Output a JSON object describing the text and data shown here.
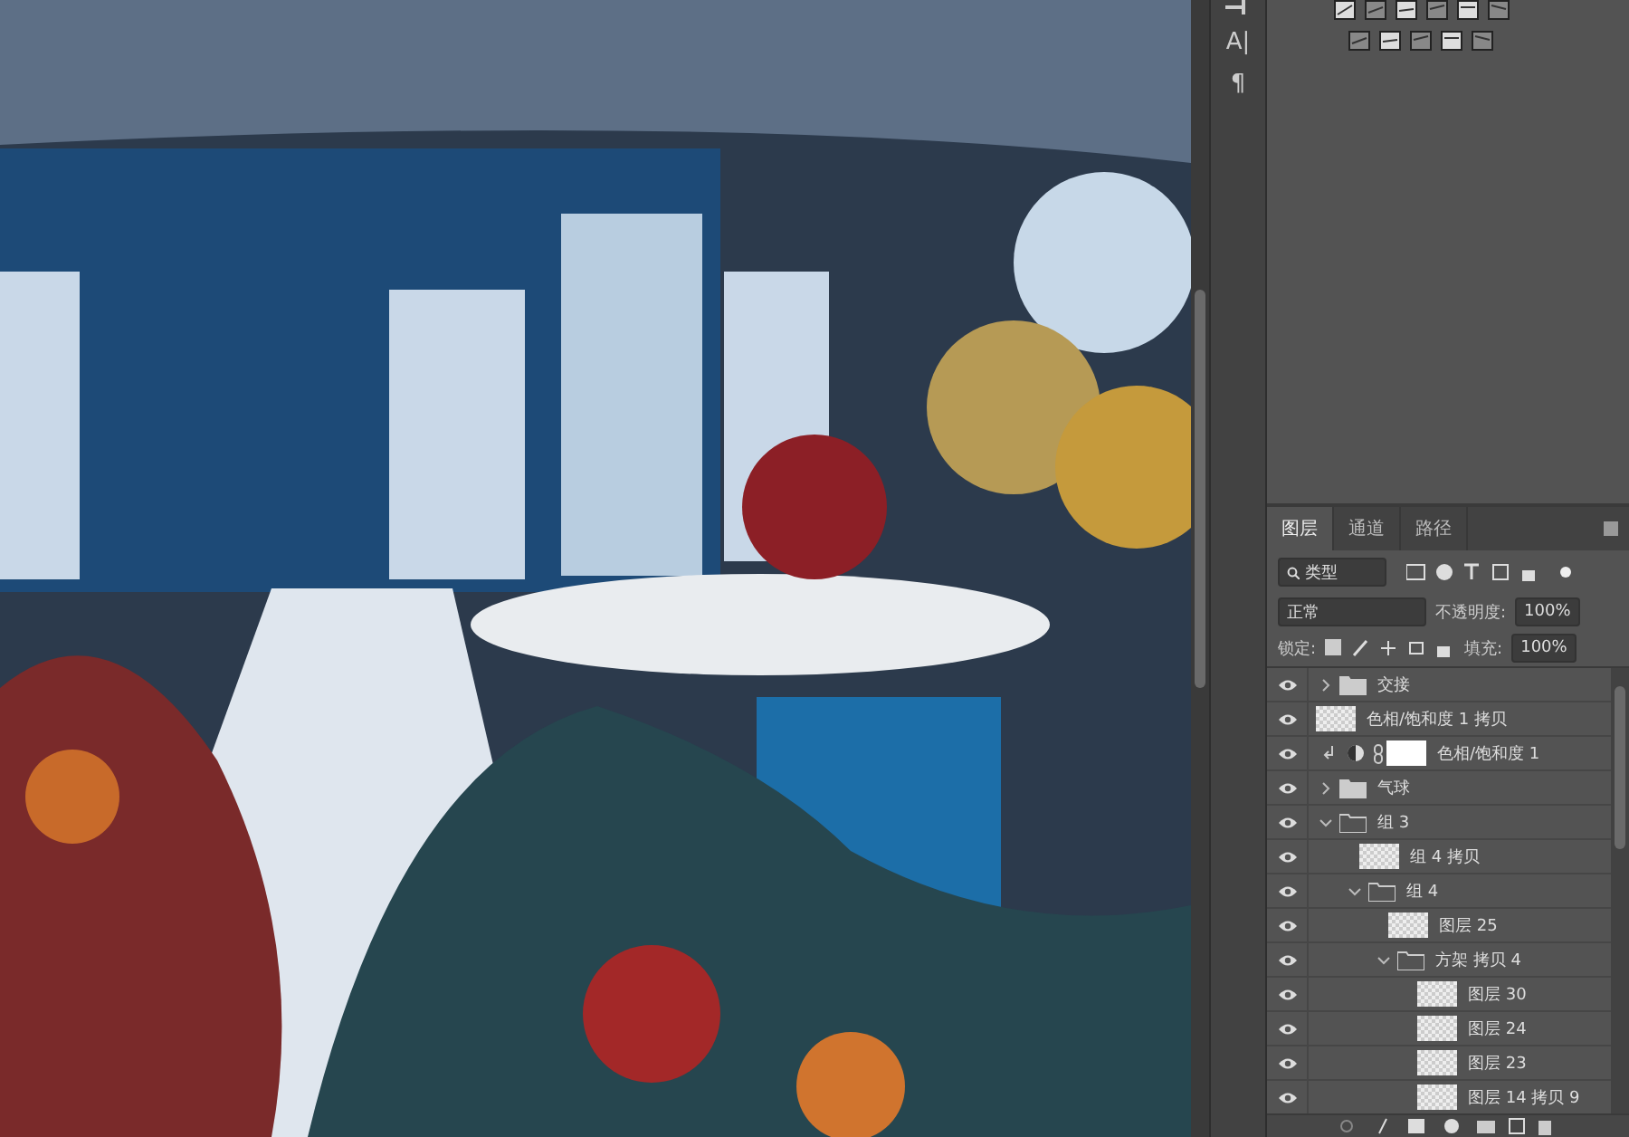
{
  "toolbar_glyphs": [
    "A|",
    "¶"
  ],
  "layers_panel": {
    "tabs": [
      {
        "label": "图层",
        "selected": true
      },
      {
        "label": "通道",
        "selected": false
      },
      {
        "label": "路径",
        "selected": false
      }
    ],
    "filter": {
      "value": "类型"
    },
    "blend_mode": {
      "value": "正常"
    },
    "opacity": {
      "label": "不透明度:",
      "value": "100%"
    },
    "lock": {
      "label": "锁定:"
    },
    "fill": {
      "label": "填充:",
      "value": "100%"
    },
    "layers": [
      {
        "name": "交接",
        "kind": "folder",
        "visible": true,
        "expanded": false
      },
      {
        "name": "色相/饱和度 1 拷贝",
        "kind": "pixel",
        "visible": true
      },
      {
        "name": "色相/饱和度 1",
        "kind": "adjustment",
        "visible": true
      },
      {
        "name": "气球",
        "kind": "folder",
        "visible": true,
        "expanded": false
      },
      {
        "name": "组 3",
        "kind": "folder",
        "visible": true,
        "expanded": true,
        "children": [
          {
            "name": "组 4 拷贝",
            "kind": "pixel",
            "visible": true
          },
          {
            "name": "组 4",
            "kind": "folder",
            "visible": true,
            "expanded": true,
            "children": [
              {
                "name": "图层 25",
                "kind": "pixel",
                "visible": true
              },
              {
                "name": "方架 拷贝 4",
                "kind": "folder",
                "visible": true,
                "expanded": true,
                "children": [
                  {
                    "name": "图层 30",
                    "kind": "pixel",
                    "visible": true
                  },
                  {
                    "name": "图层 24",
                    "kind": "pixel",
                    "visible": true
                  },
                  {
                    "name": "图层 23",
                    "kind": "pixel",
                    "visible": true
                  },
                  {
                    "name": "图层 14 拷贝 9",
                    "kind": "pixel",
                    "visible": true
                  }
                ]
              }
            ]
          }
        ]
      }
    ]
  }
}
